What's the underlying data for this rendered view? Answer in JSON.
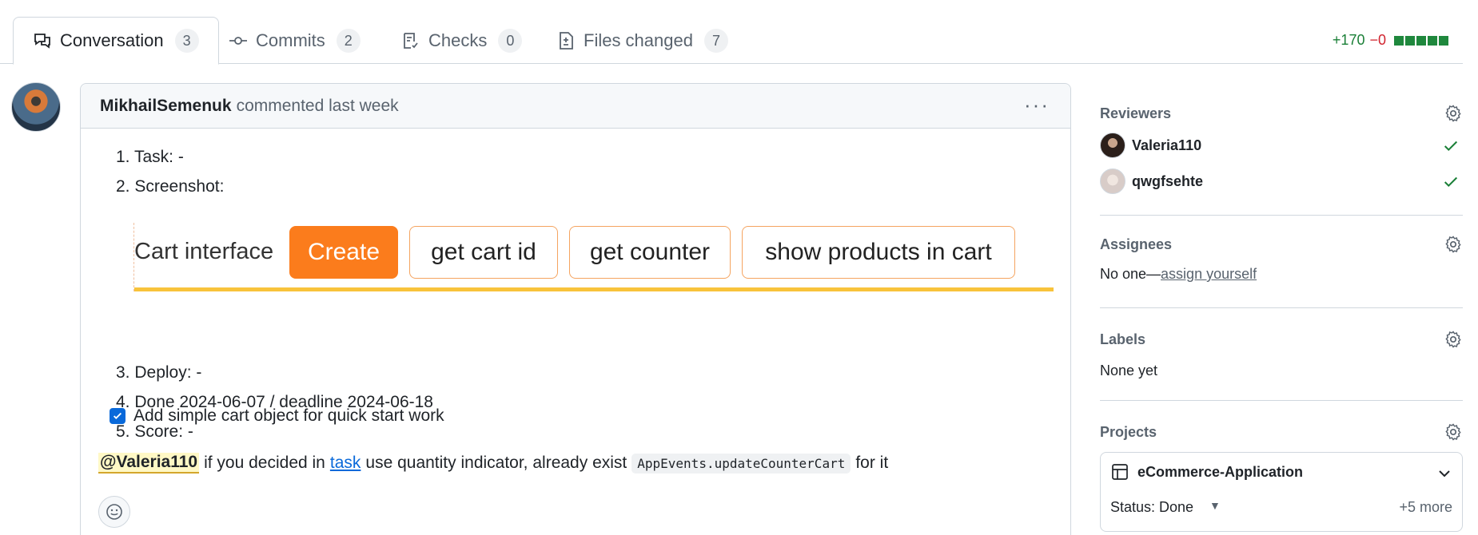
{
  "tabs": [
    {
      "label": "Conversation",
      "count": "3",
      "icon": "comment-discussion-icon"
    },
    {
      "label": "Commits",
      "count": "2",
      "icon": "git-commit-icon"
    },
    {
      "label": "Checks",
      "count": "0",
      "icon": "checklist-icon"
    },
    {
      "label": "Files changed",
      "count": "7",
      "icon": "file-diff-icon"
    }
  ],
  "diffstat": {
    "additions": "+170",
    "deletions": "−0"
  },
  "comment": {
    "author": "MikhailSemenuk",
    "meta": "commented last week",
    "items": [
      "1. Task: -",
      "2. Screenshot:",
      "3. Deploy: -",
      "4. Done 2024-06-07 / deadline 2024-06-18",
      "5. Score: -"
    ],
    "screenshot": {
      "label": "Cart interface",
      "buttons": [
        "Create",
        "get cart id",
        "get counter",
        "show products in cart"
      ]
    },
    "task_item": "Add simple cart object for quick start work",
    "mention": "@Valeria110",
    "text_1": "if you decided in",
    "link": "task",
    "text_2": "use quantity indicator, already exist",
    "code": "AppEvents.updateCounterCart",
    "text_3": "for it"
  },
  "sidebar": {
    "reviewers_title": "Reviewers",
    "reviewers": [
      "Valeria110",
      "qwgfsehte"
    ],
    "assignees_title": "Assignees",
    "assignees_none": "No one—",
    "assign_link": "assign yourself",
    "labels_title": "Labels",
    "labels_value": "None yet",
    "projects_title": "Projects",
    "project_name": "eCommerce-Application",
    "project_status": "Status: Done",
    "project_more": "+5 more"
  }
}
